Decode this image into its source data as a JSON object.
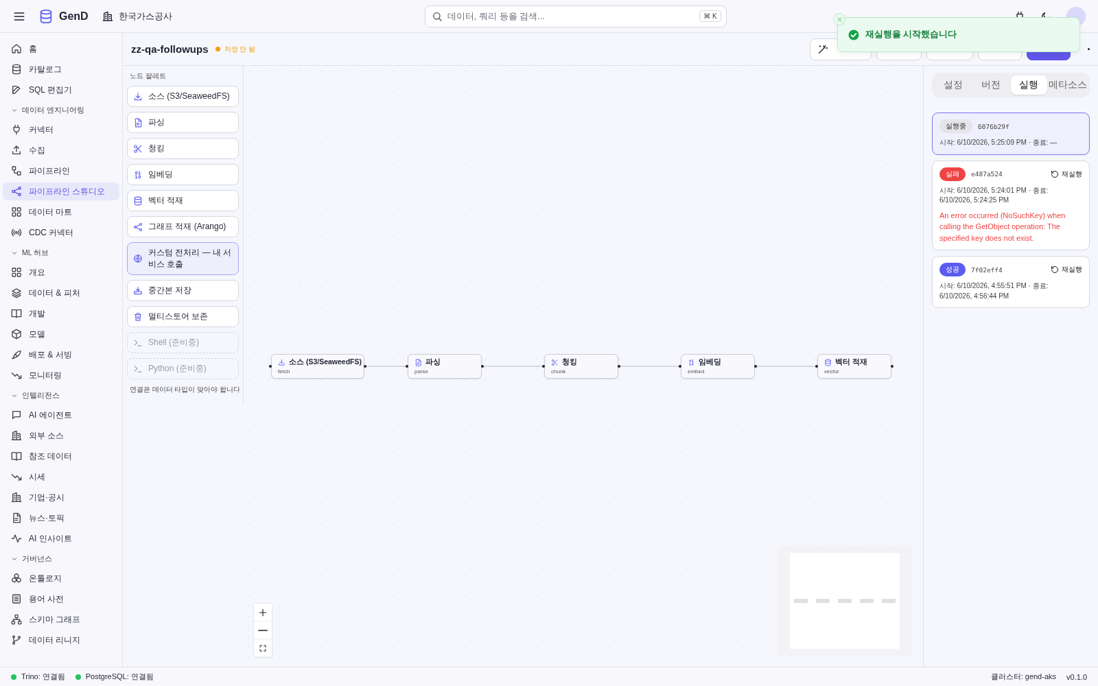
{
  "top_bar": {
    "brand": "GenD",
    "organization": "한국가스공사",
    "search": {
      "placeholder": "데이터, 쿼리 등을 검색...",
      "shortcut": "⌘ K"
    }
  },
  "sidebar": {
    "top_items": [
      {
        "label": "홈",
        "selected": false
      },
      {
        "label": "카탈로그",
        "selected": false
      },
      {
        "label": "SQL 편집기",
        "selected": false
      }
    ],
    "sections": [
      {
        "title": "데이터 엔지니어링",
        "expanded": true,
        "items": [
          {
            "label": "커넥터",
            "selected": false
          },
          {
            "label": "수집",
            "selected": false
          },
          {
            "label": "파이프라인",
            "selected": false
          },
          {
            "label": "파이프라인 스튜디오",
            "selected": true
          },
          {
            "label": "데이터 마트",
            "selected": false
          },
          {
            "label": "CDC 커넥터",
            "selected": false
          }
        ]
      },
      {
        "title": "ML 허브",
        "expanded": true,
        "items": [
          {
            "label": "개요",
            "selected": false
          },
          {
            "label": "데이터 & 피처",
            "selected": false
          },
          {
            "label": "개발",
            "selected": false
          },
          {
            "label": "모델",
            "selected": false
          },
          {
            "label": "배포 & 서빙",
            "selected": false
          },
          {
            "label": "모니터링",
            "selected": false
          }
        ]
      },
      {
        "title": "인텔리전스",
        "expanded": true,
        "items": [
          {
            "label": "AI 에이전트",
            "selected": false
          },
          {
            "label": "외부 소스",
            "selected": false
          },
          {
            "label": "참조 데이터",
            "selected": false
          },
          {
            "label": "시세",
            "selected": false
          },
          {
            "label": "기업·공시",
            "selected": false
          },
          {
            "label": "뉴스·토픽",
            "selected": false
          },
          {
            "label": "AI 인사이트",
            "selected": false
          }
        ]
      },
      {
        "title": "거버넌스",
        "expanded": true,
        "items": [
          {
            "label": "온톨로지",
            "selected": false
          },
          {
            "label": "용어 사전",
            "selected": false
          },
          {
            "label": "스키마 그래프",
            "selected": false
          },
          {
            "label": "데이터 리니지",
            "selected": false
          }
        ]
      }
    ]
  },
  "editor": {
    "title": "zz-qa-followups",
    "save_status": "저장 안 됨"
  },
  "palette": {
    "title": "노드 팔레트",
    "items": [
      {
        "label": "소스 (S3/SeaweedFS)",
        "selected": false,
        "disabled": false
      },
      {
        "label": "파싱",
        "selected": false,
        "disabled": false
      },
      {
        "label": "청킹",
        "selected": false,
        "disabled": false
      },
      {
        "label": "임베딩",
        "selected": false,
        "disabled": false
      },
      {
        "label": "벡터 적재",
        "selected": false,
        "disabled": false
      },
      {
        "label": "그래프 적재 (Arango)",
        "selected": false,
        "disabled": false
      },
      {
        "label": "커스텀 전처리 — 내 서비스 호출",
        "selected": true,
        "disabled": false
      },
      {
        "label": "중간본 저장",
        "selected": false,
        "disabled": false
      },
      {
        "label": "멀티스토어 보존",
        "selected": false,
        "disabled": false
      },
      {
        "label": "Shell (준비중)",
        "selected": false,
        "disabled": true
      },
      {
        "label": "Python (준비중)",
        "selected": false,
        "disabled": true
      }
    ],
    "hint": "연결은 데이터 타입이 맞아야 합니다"
  },
  "canvas": {
    "nodes": [
      {
        "title": "소스 (S3/SeaweedFS)",
        "subtitle": "fetch"
      },
      {
        "title": "파싱",
        "subtitle": "parse"
      },
      {
        "title": "청킹",
        "subtitle": "chunk"
      },
      {
        "title": "임베딩",
        "subtitle": "embed"
      },
      {
        "title": "벡터 적재",
        "subtitle": "vector"
      }
    ]
  },
  "right_panel": {
    "tabs": [
      {
        "label": "설정",
        "selected": false
      },
      {
        "label": "버전",
        "selected": false
      },
      {
        "label": "실행",
        "selected": true
      },
      {
        "label": "메타소스",
        "selected": false
      }
    ],
    "runs": [
      {
        "kind": "running",
        "status": "실행중",
        "id": "6076b29f",
        "time": "시작: 6/10/2026, 5:25:09 PM · 종료: —",
        "selected": true
      },
      {
        "kind": "failed",
        "status": "실패",
        "id": "e487a524",
        "time": "시작: 6/10/2026, 5:24:01 PM · 종료: 6/10/2026, 5:24:25 PM",
        "error": "An error occurred (NoSuchKey) when calling the GetObject operation: The specified key does not exist.",
        "retry": "재실행",
        "selected": false
      },
      {
        "kind": "success",
        "status": "성공",
        "id": "7f02eff4",
        "time": "시작: 6/10/2026, 4:55:51 PM · 종료: 6/10/2026, 4:56:44 PM",
        "retry": "재실행",
        "selected": false
      }
    ]
  },
  "toast": {
    "message": "재실행을 시작했습니다"
  },
  "status_bar": {
    "connections": [
      {
        "label": "Trino: 연결됨",
        "color": "#22c55e"
      },
      {
        "label": "PostgreSQL: 연결됨",
        "color": "#22c55e"
      }
    ],
    "cluster": "클러스터: gend-aks",
    "version": "v0.1.0"
  }
}
